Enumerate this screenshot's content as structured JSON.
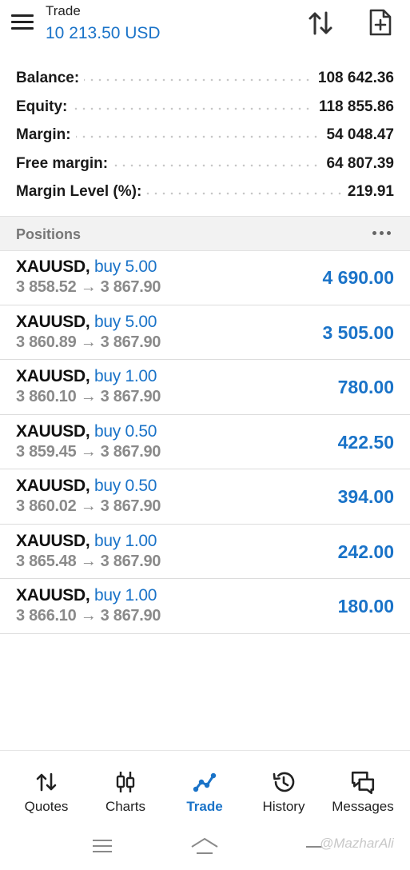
{
  "header": {
    "title": "Trade",
    "subtitle": "10 213.50 USD"
  },
  "summary": [
    {
      "label": "Balance:",
      "value": "108 642.36"
    },
    {
      "label": "Equity:",
      "value": "118 855.86"
    },
    {
      "label": "Margin:",
      "value": "54 048.47"
    },
    {
      "label": "Free margin:",
      "value": "64 807.39"
    },
    {
      "label": "Margin Level (%):",
      "value": "219.91"
    }
  ],
  "positions_section": {
    "title": "Positions"
  },
  "positions": [
    {
      "symbol": "XAUUSD,",
      "type": "buy 5.00",
      "prices": "3 858.52 → 3 867.90",
      "profit": "4 690.00"
    },
    {
      "symbol": "XAUUSD,",
      "type": "buy 5.00",
      "prices": "3 860.89 → 3 867.90",
      "profit": "3 505.00"
    },
    {
      "symbol": "XAUUSD,",
      "type": "buy 1.00",
      "prices": "3 860.10 → 3 867.90",
      "profit": "780.00"
    },
    {
      "symbol": "XAUUSD,",
      "type": "buy 0.50",
      "prices": "3 859.45 → 3 867.90",
      "profit": "422.50"
    },
    {
      "symbol": "XAUUSD,",
      "type": "buy 0.50",
      "prices": "3 860.02 → 3 867.90",
      "profit": "394.00"
    },
    {
      "symbol": "XAUUSD,",
      "type": "buy 1.00",
      "prices": "3 865.48 → 3 867.90",
      "profit": "242.00"
    },
    {
      "symbol": "XAUUSD,",
      "type": "buy 1.00",
      "prices": "3 866.10 → 3 867.90",
      "profit": "180.00"
    }
  ],
  "nav": {
    "items": [
      {
        "label": "Quotes",
        "icon": "quotes-icon"
      },
      {
        "label": "Charts",
        "icon": "charts-icon"
      },
      {
        "label": "Trade",
        "icon": "trade-icon",
        "active": true
      },
      {
        "label": "History",
        "icon": "history-icon"
      },
      {
        "label": "Messages",
        "icon": "messages-icon"
      }
    ]
  },
  "watermark": "@MazharAli",
  "colors": {
    "accent": "#1a73c8",
    "text": "#1a1a1a",
    "muted": "#8a8a8a",
    "section_bg": "#f2f2f2"
  }
}
